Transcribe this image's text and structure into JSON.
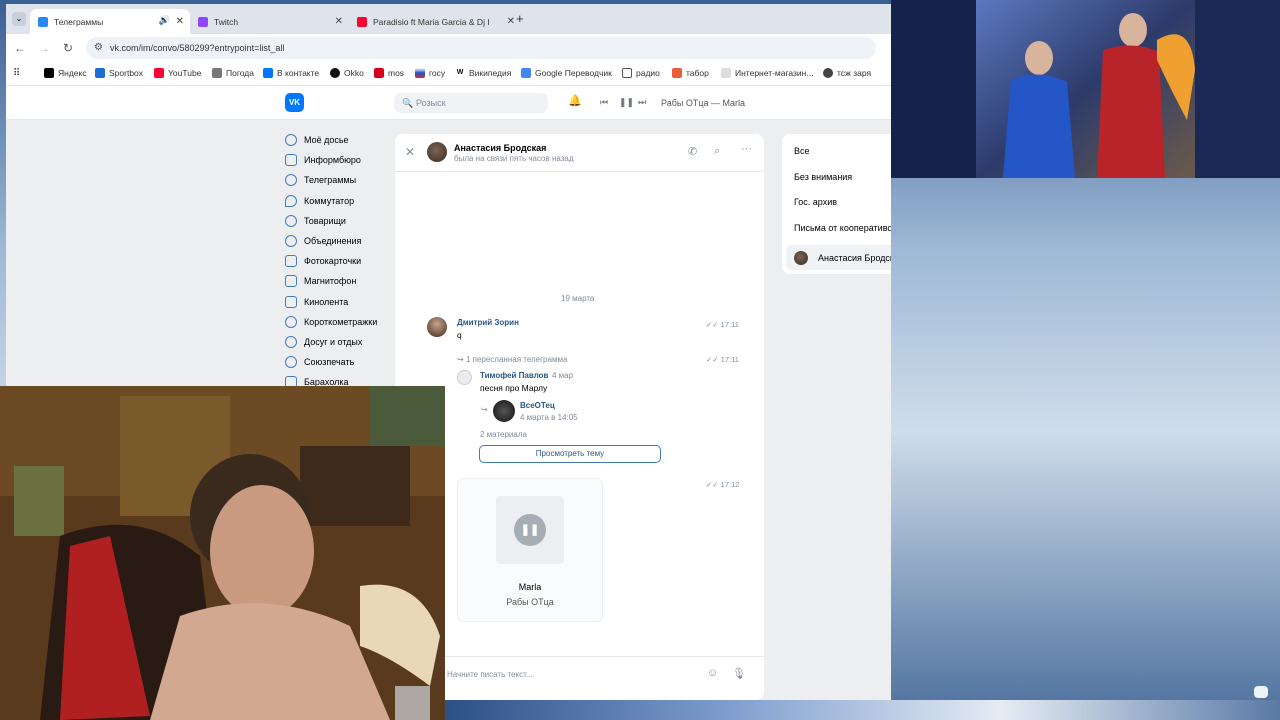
{
  "browser": {
    "tabs": [
      {
        "title": "Телеграммы",
        "color": "#2787f5"
      },
      {
        "title": "Twitch",
        "color": "#9146ff"
      },
      {
        "title": "Paradisio ft Maria Garcia & Dj I",
        "color": "#ff0033"
      }
    ],
    "new_tab": "+",
    "url": "vk.com/im/convo/580299?entrypoint=list_all",
    "bookmarks": [
      "Яндекс",
      "Sportbox",
      "YouTube",
      "Погода",
      "В контакте",
      "Okko",
      "mos",
      "госу",
      "Википедия",
      "Google Переводчик",
      "радио",
      "табор",
      "Интернет-магазин...",
      "тсж заря"
    ]
  },
  "vk": {
    "search_placeholder": "Розыск",
    "player_track": "Рабы ОТца — Marla",
    "menu": [
      "Моё досье",
      "Информбюро",
      "Телеграммы",
      "Коммутатор",
      "Товарищи",
      "Объединения",
      "Фотокарточки",
      "Магнитофон",
      "Кинолента",
      "Короткометражки",
      "Досуг и отдых",
      "Союзпечать",
      "Барахолка"
    ],
    "chat": {
      "name": "Анастасия Бродская",
      "status": "была на связи пять часов назад",
      "date_divider": "19 марта",
      "msg1": {
        "sender": "Дмитрий Зорин",
        "text": "q",
        "time": "17:11"
      },
      "forward": {
        "label": "1 пересланная телеграмма",
        "time": "17:11",
        "author": "Тимофей Павлов",
        "author_date": "4 мар",
        "text": "песня про Марлу",
        "group": "ВсеОТец",
        "group_date": "4 марта в 14:05",
        "materials": "2 материала",
        "button": "Просмотреть тему"
      },
      "audio": {
        "time": "17:12",
        "title": "Marla",
        "artist": "Рабы ОТца",
        "pause": "❚❚"
      },
      "composer_placeholder": "Начните писать текст..."
    },
    "folders": [
      "Все",
      "Без внимания",
      "Гос. архив",
      "Письма от кооперативов"
    ],
    "selected_dialog": "Анастасия Бродская"
  }
}
